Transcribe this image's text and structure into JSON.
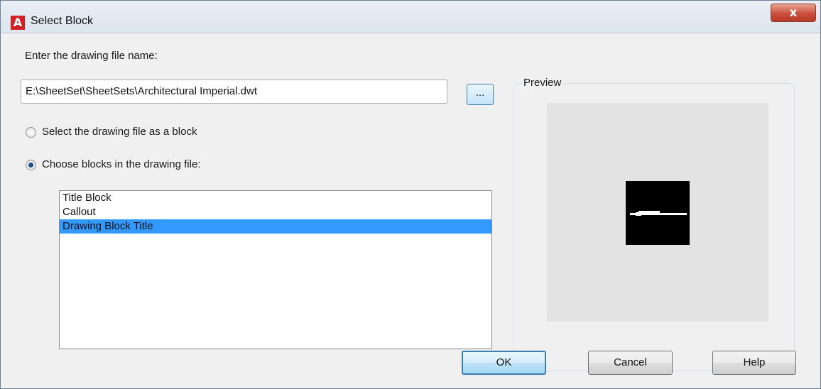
{
  "window": {
    "title": "Select Block",
    "app_icon_letter": "A",
    "close_glyph": "x"
  },
  "file_section": {
    "label": "Enter the drawing file name:",
    "path_value": "E:\\SheetSet\\SheetSets\\Architectural Imperial.dwt",
    "browse_label": "..."
  },
  "options": {
    "as_block_label": "Select the drawing file as a block",
    "choose_blocks_label": "Choose blocks in the drawing file:",
    "selected": "choose_blocks"
  },
  "blocks_list": {
    "items": [
      "Title Block",
      "Callout",
      "Drawing Block Title"
    ],
    "selected_index": 2
  },
  "preview": {
    "label": "Preview"
  },
  "buttons": {
    "ok": "OK",
    "cancel": "Cancel",
    "help": "Help"
  },
  "colors": {
    "selection": "#3399ff",
    "accent_border": "#3c7fb1",
    "close_red": "#c9503c",
    "app_icon_red": "#d22126"
  }
}
